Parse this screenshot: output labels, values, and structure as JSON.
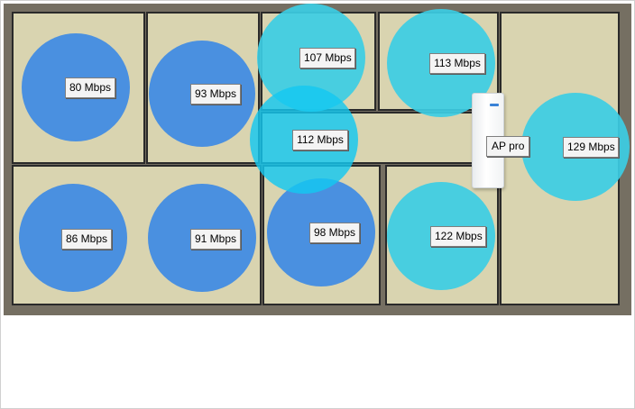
{
  "access_point": {
    "label": "AP pro"
  },
  "colors": {
    "strong_signal": "#4a90e0",
    "medium_signal": "#3ec8e0",
    "wall": "#756f62",
    "floor": "#d9d4b0"
  },
  "measurements": [
    {
      "id": "m1",
      "label": "80 Mbps",
      "value_mbps": 80
    },
    {
      "id": "m2",
      "label": "93 Mbps",
      "value_mbps": 93
    },
    {
      "id": "m3",
      "label": "107 Mbps",
      "value_mbps": 107
    },
    {
      "id": "m4",
      "label": "113 Mbps",
      "value_mbps": 113
    },
    {
      "id": "m5",
      "label": "112 Mbps",
      "value_mbps": 112
    },
    {
      "id": "m6",
      "label": "129 Mbps",
      "value_mbps": 129
    },
    {
      "id": "m7",
      "label": "86 Mbps",
      "value_mbps": 86
    },
    {
      "id": "m8",
      "label": "91 Mbps",
      "value_mbps": 91
    },
    {
      "id": "m9",
      "label": "98 Mbps",
      "value_mbps": 98
    },
    {
      "id": "m10",
      "label": "122 Mbps",
      "value_mbps": 122
    }
  ]
}
